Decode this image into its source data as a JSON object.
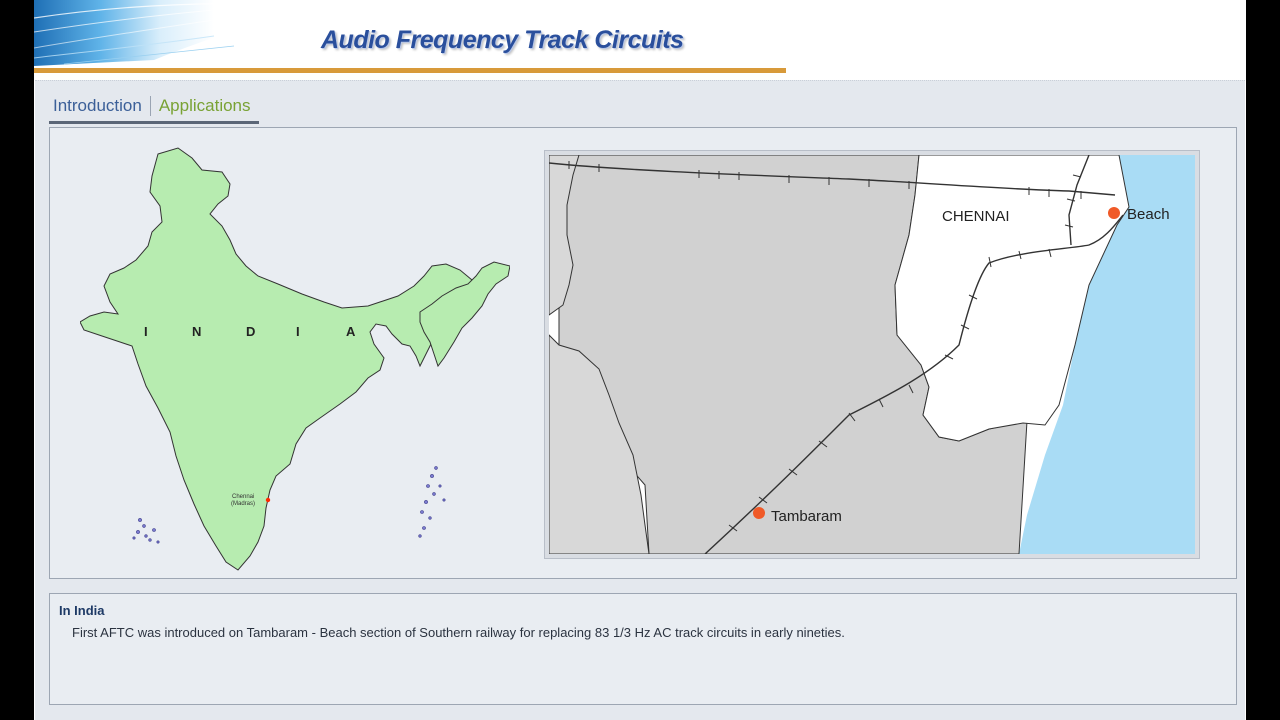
{
  "header": {
    "title": "Audio Frequency Track Circuits"
  },
  "tabs": [
    {
      "label": "Introduction"
    },
    {
      "label": "Applications",
      "active": true
    }
  ],
  "india_map": {
    "country_label": [
      "I",
      "N",
      "D",
      "I",
      "A"
    ],
    "city_label_1": "Chennai",
    "city_label_2": "(Madras)",
    "land_color": "#b7ecb0",
    "marker_color": "#ff2a00"
  },
  "detail_map": {
    "city_label": "CHENNAI",
    "station_north": "Beach",
    "station_south": "Tambaram",
    "sea_color": "#a9dcf5",
    "land_color": "#d1d1d1",
    "city_area_color": "#ffffff",
    "station_color": "#f05a28"
  },
  "info": {
    "heading": "In India",
    "text": "First AFTC was introduced on Tambaram - Beach section of Southern railway for replacing 83 1/3 Hz AC track circuits in early nineties."
  }
}
